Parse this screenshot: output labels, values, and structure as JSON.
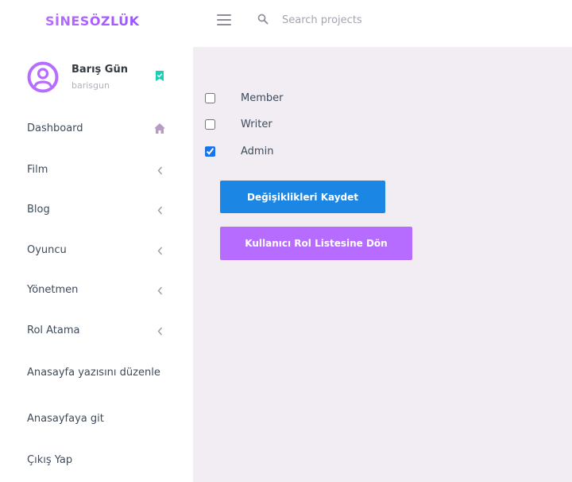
{
  "brand": {
    "logo": "SİNESÖZLÜK"
  },
  "topbar": {
    "search_placeholder": "Search projects"
  },
  "profile": {
    "name": "Barış Gün",
    "username": "barisgun"
  },
  "sidebar": {
    "items": [
      {
        "label": "Dashboard",
        "icon": "home-icon"
      },
      {
        "label": "Film",
        "icon": "chevron-left-icon"
      },
      {
        "label": "Blog",
        "icon": "chevron-left-icon"
      },
      {
        "label": "Oyuncu",
        "icon": "chevron-left-icon"
      },
      {
        "label": "Yönetmen",
        "icon": "chevron-left-icon"
      },
      {
        "label": "Rol Atama",
        "icon": "chevron-left-icon"
      },
      {
        "label": "Anasayfa yazısını düzenle"
      },
      {
        "label": "Anasayfaya git"
      },
      {
        "label": "Çıkış Yap"
      }
    ]
  },
  "roles": [
    {
      "label": "Member",
      "checked": false
    },
    {
      "label": "Writer",
      "checked": false
    },
    {
      "label": "Admin",
      "checked": true
    }
  ],
  "actions": {
    "save_label": "Değişiklikleri Kaydet",
    "back_label": "Kullanıcı Rol Listesine Dön"
  },
  "colors": {
    "accent_purple": "#b66dff",
    "save_blue": "#1b86e3",
    "badge_teal": "#1bcfb4",
    "content_bg": "#f2edf3"
  }
}
